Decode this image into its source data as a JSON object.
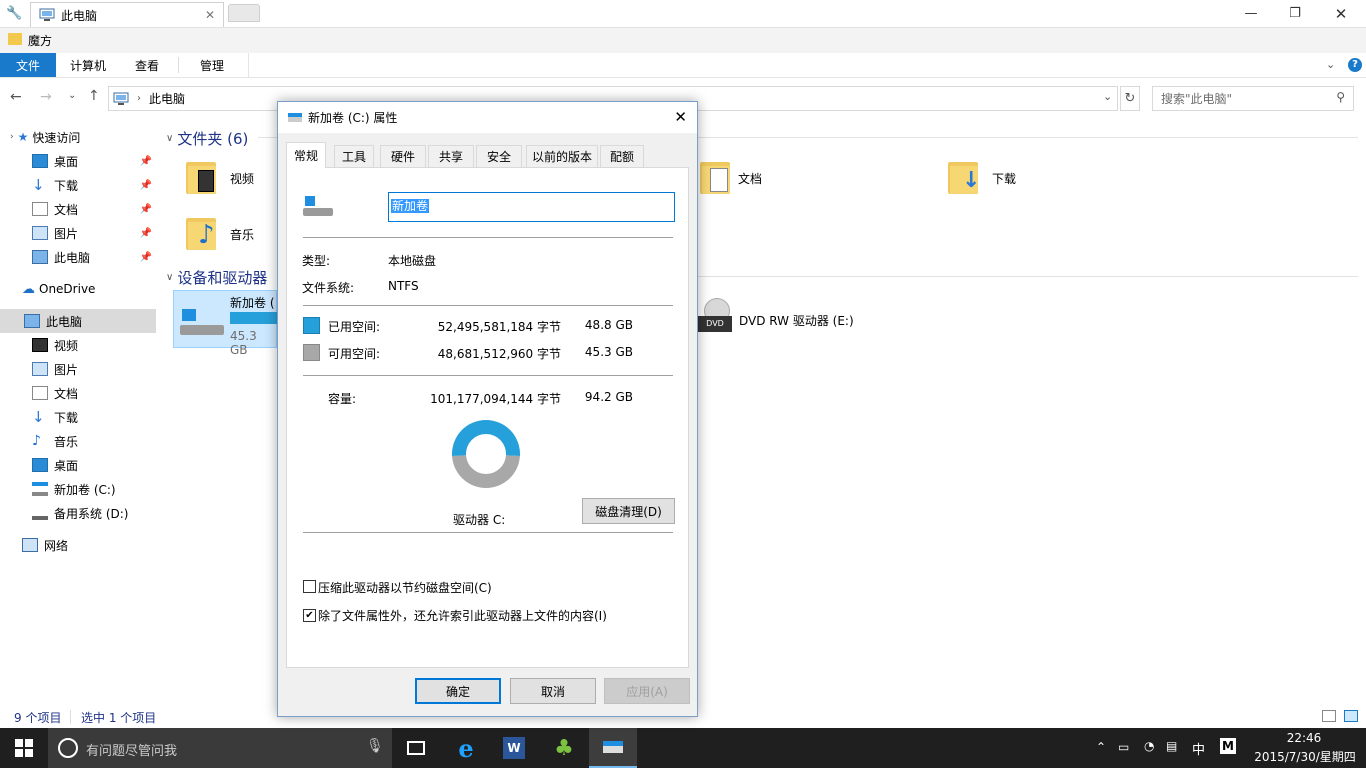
{
  "window": {
    "tab_title": "此电脑",
    "favorites_folder": "魔方"
  },
  "ribbon": {
    "tabs": [
      "文件",
      "计算机",
      "查看",
      "管理"
    ]
  },
  "address": {
    "path": "此电脑",
    "search_placeholder": "搜索\"此电脑\""
  },
  "nav": {
    "quick_access": "快速访问",
    "quick_items": [
      "桌面",
      "下载",
      "文档",
      "图片",
      "此电脑"
    ],
    "onedrive": "OneDrive",
    "this_pc": "此电脑",
    "pc_items": [
      "视频",
      "图片",
      "文档",
      "下载",
      "音乐",
      "桌面",
      "新加卷 (C:)",
      "备用系统 (D:)"
    ],
    "network": "网络"
  },
  "content": {
    "folders_header": "文件夹 (6)",
    "folders": [
      "视频",
      "文档",
      "下载",
      "音乐"
    ],
    "devices_header": "设备和驱动器",
    "drive_c_label": "新加卷 (",
    "drive_c_free": "45.3 GB",
    "dvd_label": "DVD RW 驱动器 (E:)"
  },
  "status": {
    "items": "9 个项目",
    "selected": "选中 1 个项目"
  },
  "taskbar": {
    "search_placeholder": "有问题尽管问我",
    "ime": "中",
    "time": "22:46",
    "date": "2015/7/30/星期四"
  },
  "dialog": {
    "title": "新加卷 (C:) 属性",
    "tabs": [
      "常规",
      "工具",
      "硬件",
      "共享",
      "安全",
      "以前的版本",
      "配额"
    ],
    "volume_name": "新加卷",
    "type_label": "类型:",
    "type_value": "本地磁盘",
    "fs_label": "文件系统:",
    "fs_value": "NTFS",
    "used_label": "已用空间:",
    "used_bytes": "52,495,581,184 字节",
    "used_gb": "48.8 GB",
    "free_label": "可用空间:",
    "free_bytes": "48,681,512,960 字节",
    "free_gb": "45.3 GB",
    "cap_label": "容量:",
    "cap_bytes": "101,177,094,144 字节",
    "cap_gb": "94.2 GB",
    "drive_label": "驱动器 C:",
    "cleanup_button": "磁盘清理(D)",
    "compress_label": "压缩此驱动器以节约磁盘空间(C)",
    "index_label": "除了文件属性外，还允许索引此驱动器上文件的内容(I)",
    "ok": "确定",
    "cancel": "取消",
    "apply": "应用(A)",
    "used_fraction": 0.519,
    "used_color": "#26a0da",
    "free_color": "#a8a8a8"
  }
}
